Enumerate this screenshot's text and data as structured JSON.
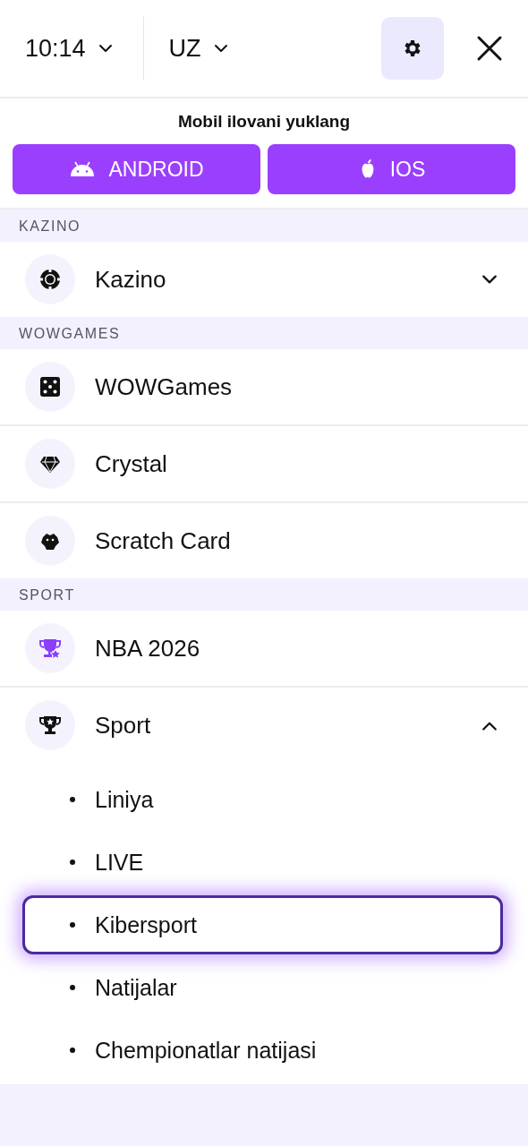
{
  "header": {
    "time": "10:14",
    "language": "UZ"
  },
  "download": {
    "title": "Mobil ilovani yuklang",
    "buttons": [
      {
        "kind": "android",
        "label": "ANDROID"
      },
      {
        "kind": "ios",
        "label": "IOS"
      }
    ]
  },
  "sections": [
    {
      "heading": "KAZINO",
      "items": [
        {
          "kind": "chip",
          "label": "Kazino",
          "expanded": false
        }
      ]
    },
    {
      "heading": "WOWGAMES",
      "items": [
        {
          "kind": "dice",
          "label": "WOWGames"
        },
        {
          "kind": "diamond",
          "label": "Crystal"
        },
        {
          "kind": "scratch",
          "label": "Scratch Card"
        }
      ]
    },
    {
      "heading": "SPORT",
      "items": [
        {
          "kind": "trophy_star",
          "label": "NBA 2026"
        },
        {
          "kind": "trophy",
          "label": "Sport",
          "expanded": true,
          "children": [
            {
              "label": "Liniya",
              "selected": false
            },
            {
              "label": "LIVE",
              "selected": false
            },
            {
              "label": "Kibersport",
              "selected": true
            },
            {
              "label": "Natijalar",
              "selected": false
            },
            {
              "label": "Chempionatlar natijasi",
              "selected": false
            }
          ]
        }
      ]
    }
  ]
}
